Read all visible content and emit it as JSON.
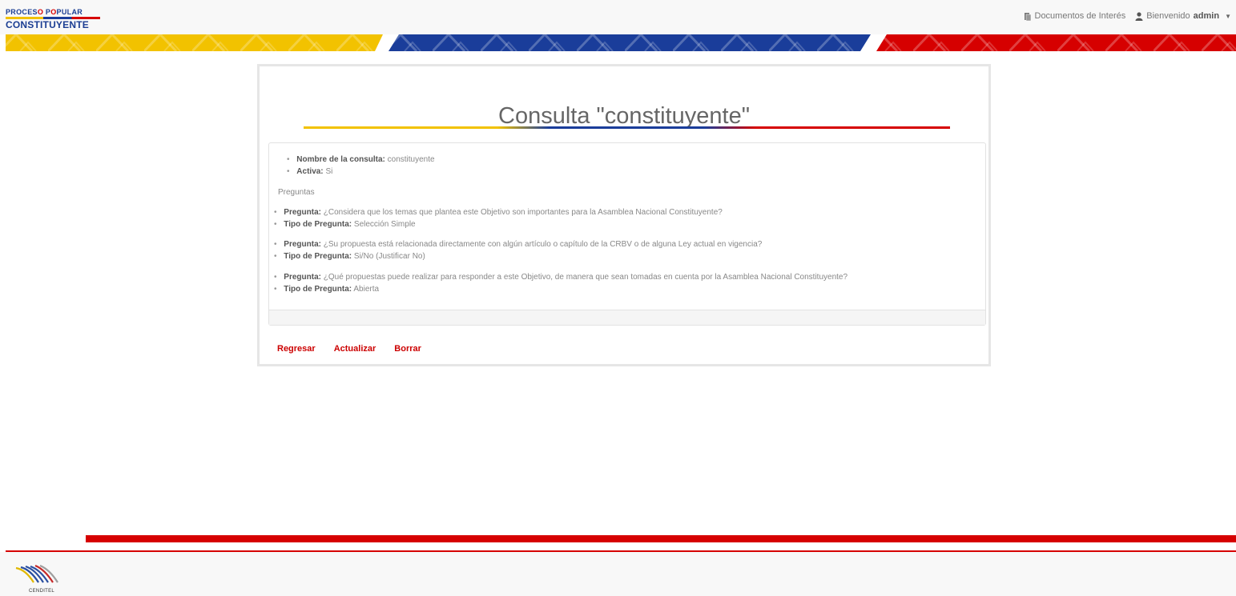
{
  "header": {
    "logo_line1_a": "PROCES",
    "logo_line1_b": "O",
    "logo_line1_c": " P",
    "logo_line1_d": "O",
    "logo_line1_e": "PULAR",
    "logo_line2": "CONSTITUYENTE",
    "docs_label": "Documentos de Interés",
    "welcome_label": "Bienvenido",
    "username": "admin",
    "docs_icon": "document-icon",
    "user_icon": "user-icon"
  },
  "colors": {
    "yellow": "#f2c200",
    "blue": "#1a3d9a",
    "red": "#d60000",
    "link_red": "#cc0000"
  },
  "consulta": {
    "title": "Consulta \"constituyente\"",
    "nombre_label": "Nombre de la consulta:",
    "nombre_value": "constituyente",
    "activa_label": "Activa:",
    "activa_value": "Si",
    "preguntas_label": "Preguntas",
    "preguntas": [
      {
        "pregunta_label": "Pregunta:",
        "pregunta_text": "¿Considera que los temas que plantea este Objetivo son importantes para la Asamblea Nacional Constituyente?",
        "tipo_label": "Tipo de Pregunta:",
        "tipo_value": "Selección Simple"
      },
      {
        "pregunta_label": "Pregunta:",
        "pregunta_text": "¿Su propuesta está relacionada directamente con algún artículo o capítulo de la CRBV o de alguna Ley actual en vigencia?",
        "tipo_label": "Tipo de Pregunta:",
        "tipo_value": "Si/No (Justificar No)"
      },
      {
        "pregunta_label": "Pregunta:",
        "pregunta_text": "¿Qué propuestas puede realizar para responder a este Objetivo, de manera que sean tomadas en cuenta por la Asamblea Nacional Constituyente?",
        "tipo_label": "Tipo de Pregunta:",
        "tipo_value": "Abierta"
      }
    ]
  },
  "actions": {
    "regresar": "Regresar",
    "actualizar": "Actualizar",
    "borrar": "Borrar"
  },
  "footer": {
    "org_logo_text": "CENDITEL"
  }
}
